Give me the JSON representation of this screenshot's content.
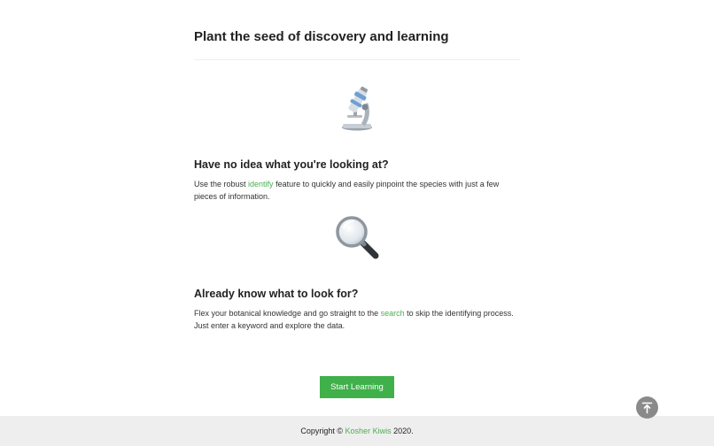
{
  "page": {
    "title": "Plant the seed of discovery and learning"
  },
  "identify_section": {
    "icon": "microscope-icon",
    "heading": "Have no idea what you're looking at?",
    "text_before": "Use the robust ",
    "link_label": "identify",
    "text_after": " feature to quickly and easily pinpoint the species with just a few pieces of information."
  },
  "search_section": {
    "icon": "magnifying-glass-icon",
    "heading": "Already know what to look for?",
    "text_before": "Flex your botanical knowledge and go straight to the ",
    "link_label": "search",
    "text_after": " to skip the identifying process. Just enter a keyword and explore the data."
  },
  "cta": {
    "start_label": "Start Learning"
  },
  "scroll_top": {
    "icon": "arrow-up-to-top-icon"
  },
  "footer": {
    "copyright_prefix": "Copyright © ",
    "brand": "Kosher Kiwis",
    "year_suffix": " 2020."
  },
  "colors": {
    "accent": "#4caf50",
    "button": "#3fb04a",
    "footer_bg": "#eeeeee",
    "scroll_button": "#8a8a8a"
  }
}
